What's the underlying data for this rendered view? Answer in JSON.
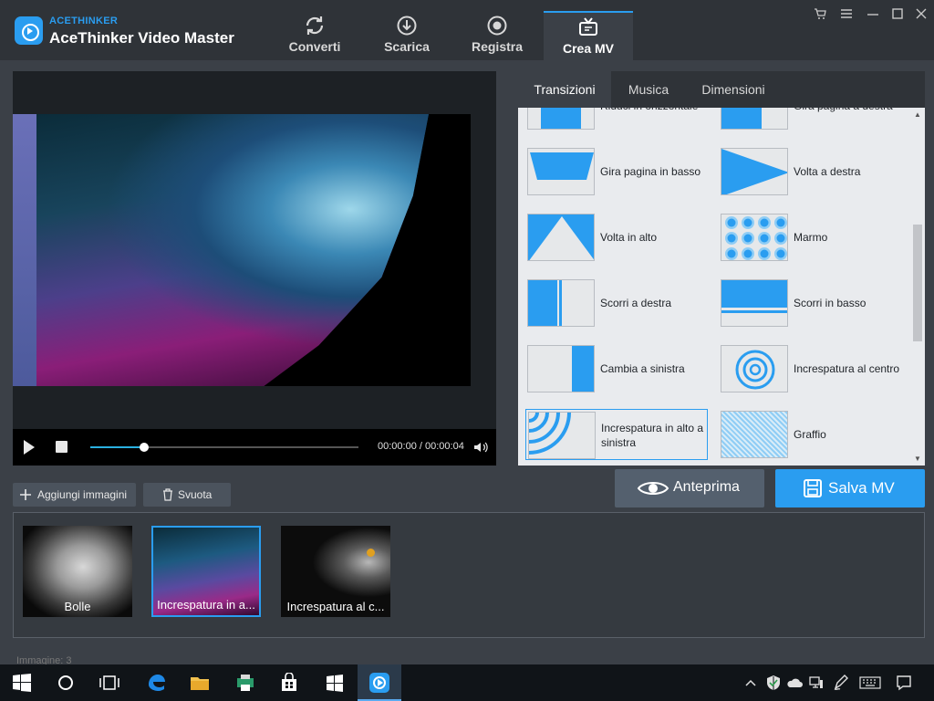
{
  "titlebar": {
    "brand_small": "ACETHINKER",
    "brand_main": "AceThinker Video Master",
    "tabs": [
      {
        "label": "Converti",
        "icon": "refresh-icon"
      },
      {
        "label": "Scarica",
        "icon": "download-icon"
      },
      {
        "label": "Registra",
        "icon": "record-icon"
      },
      {
        "label": "Crea MV",
        "icon": "tv-icon"
      }
    ],
    "active_tab": "Crea MV",
    "window_controls": [
      "cart-icon",
      "menu-icon",
      "minimize-icon",
      "maximize-icon",
      "close-icon"
    ]
  },
  "player": {
    "timecode": "00:00:00 / 00:00:04",
    "progress": 0.2
  },
  "panel": {
    "tabs": [
      "Transizioni",
      "Musica",
      "Dimensioni"
    ],
    "active_tab": "Transizioni",
    "transitions": [
      {
        "label": "Riduci in orizzontale"
      },
      {
        "label": "Gira pagina a destra"
      },
      {
        "label": "Gira pagina in basso"
      },
      {
        "label": "Volta a destra"
      },
      {
        "label": "Volta in alto"
      },
      {
        "label": "Marmo"
      },
      {
        "label": "Scorri a destra"
      },
      {
        "label": "Scorri in basso"
      },
      {
        "label": "Cambia a sinistra"
      },
      {
        "label": "Increspatura al centro"
      },
      {
        "label": "Increspatura in alto a sinistra"
      },
      {
        "label": "Graffio"
      }
    ],
    "selected_transition": "Increspatura in alto a sinistra"
  },
  "buttons": {
    "preview": "Anteprima",
    "save": "Salva MV",
    "add_images": "Aggiungi immagini",
    "clear": "Svuota"
  },
  "storyboard": {
    "clips": [
      {
        "label": "Bolle"
      },
      {
        "label": "Increspatura in a..."
      },
      {
        "label": "Increspatura al c..."
      }
    ],
    "selected_index": 1
  },
  "status": "Immagine: 3",
  "colors": {
    "accent": "#2a9df0",
    "titlebar_bg": "#2f3338",
    "app_bg": "#3b4047"
  }
}
